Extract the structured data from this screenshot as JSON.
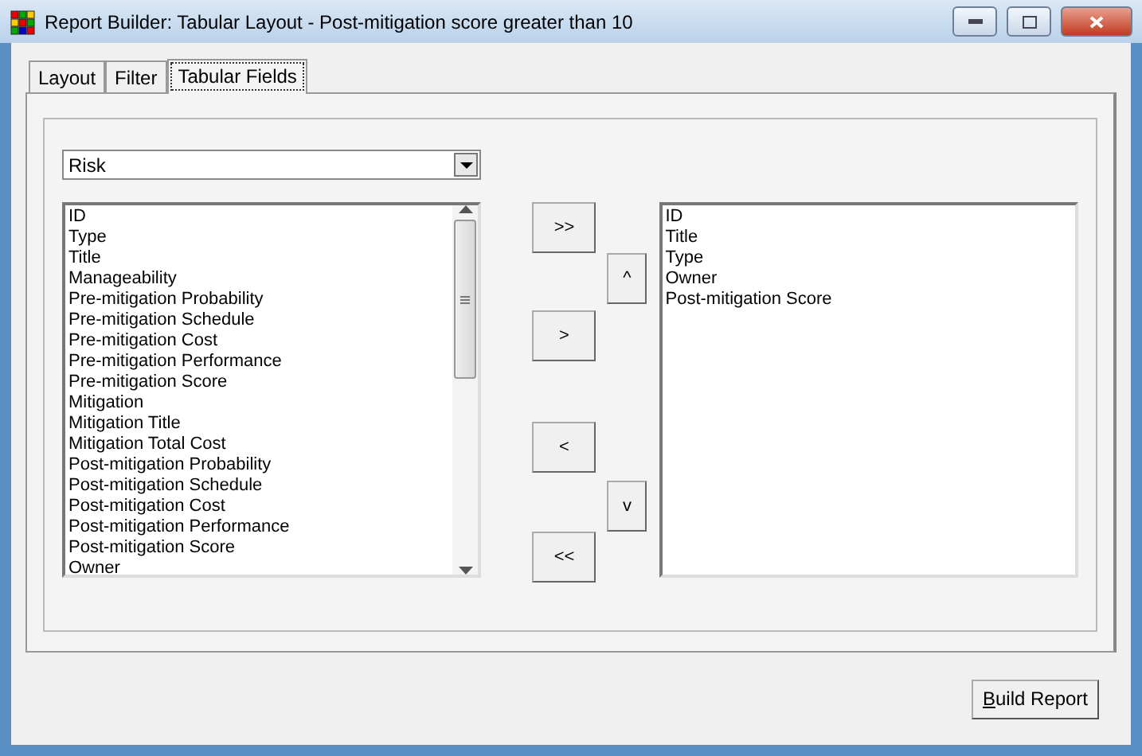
{
  "window": {
    "title": "Report Builder: Tabular Layout - Post-mitigation score greater than 10"
  },
  "tabs": [
    {
      "label": "Layout",
      "selected": false
    },
    {
      "label": "Filter",
      "selected": false
    },
    {
      "label": "Tabular Fields",
      "selected": true
    }
  ],
  "source": {
    "value": "Risk"
  },
  "available_fields": [
    "ID",
    "Type",
    "Title",
    "Manageability",
    "Pre-mitigation Probability",
    "Pre-mitigation Schedule",
    "Pre-mitigation Cost",
    "Pre-mitigation Performance",
    "Pre-mitigation Score",
    "Mitigation",
    "Mitigation Title",
    "Mitigation Total Cost",
    "Post-mitigation Probability",
    "Post-mitigation Schedule",
    "Post-mitigation Cost",
    "Post-mitigation Performance",
    "Post-mitigation Score",
    "Owner"
  ],
  "move_buttons": {
    "add_all": ">>",
    "add": ">",
    "remove": "<",
    "remove_all": "<<",
    "up": "^",
    "down": "v"
  },
  "selected_fields": [
    "ID",
    "Title",
    "Type",
    "Owner",
    "Post-mitigation Score"
  ],
  "build_button": "Build Report"
}
